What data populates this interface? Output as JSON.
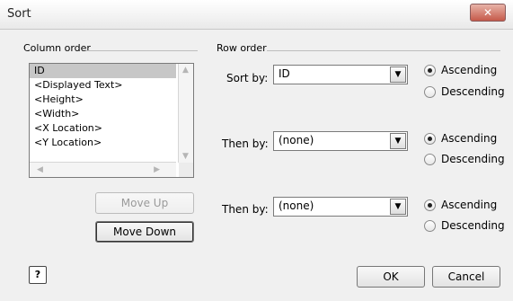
{
  "window": {
    "title": "Sort",
    "close_glyph": "✕"
  },
  "column_order": {
    "label": "Column order",
    "items": [
      "ID",
      "<Displayed Text>",
      "<Height>",
      "<Width>",
      "<X Location>",
      "<Y Location>"
    ],
    "selected_index": 0,
    "move_up": "Move Up",
    "move_down": "Move Down"
  },
  "row_order": {
    "label": "Row order",
    "rows": [
      {
        "label": "Sort by:",
        "value": "ID",
        "ascending": "Ascending",
        "descending": "Descending",
        "selected": "ascending"
      },
      {
        "label": "Then by:",
        "value": "(none)",
        "ascending": "Ascending",
        "descending": "Descending",
        "selected": "ascending"
      },
      {
        "label": "Then by:",
        "value": "(none)",
        "ascending": "Ascending",
        "descending": "Descending",
        "selected": "ascending"
      }
    ]
  },
  "footer": {
    "help_glyph": "?",
    "ok": "OK",
    "cancel": "Cancel"
  }
}
